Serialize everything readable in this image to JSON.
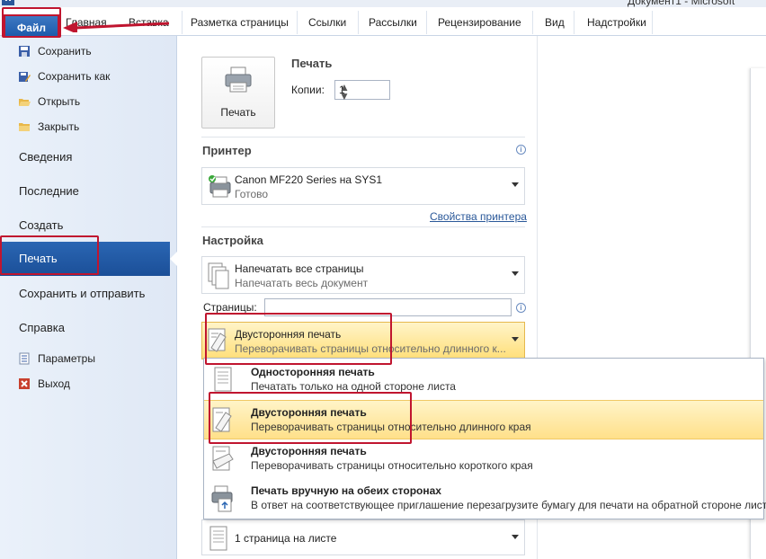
{
  "window": {
    "title": "Документ1 - Microsoft",
    "app_icon": "W"
  },
  "ribbon": {
    "file_tab": "Файл",
    "tabs": [
      "Главная",
      "Вставка",
      "Разметка страницы",
      "Ссылки",
      "Рассылки",
      "Рецензирование",
      "Вид",
      "Надстройки"
    ]
  },
  "sidebar": {
    "commands": [
      {
        "label": "Сохранить",
        "icon": "floppy-disk-icon"
      },
      {
        "label": "Сохранить как",
        "icon": "save-as-icon"
      },
      {
        "label": "Открыть",
        "icon": "open-folder-icon"
      },
      {
        "label": "Закрыть",
        "icon": "close-folder-icon"
      }
    ],
    "sections": [
      "Сведения",
      "Последние",
      "Создать",
      "Печать",
      "Сохранить и отправить",
      "Справка"
    ],
    "active_section": "Печать",
    "bottom_commands": [
      {
        "label": "Параметры",
        "icon": "options-icon"
      },
      {
        "label": "Выход",
        "icon": "exit-icon"
      }
    ]
  },
  "print": {
    "heading": "Печать",
    "button_label": "Печать",
    "copies_label": "Копии:",
    "copies_value": "1",
    "printer_heading": "Принтер",
    "printer_name": "Canon MF220 Series на SYS1",
    "printer_status": "Готово",
    "printer_props_link": "Свойства принтера",
    "settings_heading": "Настройка",
    "pages_option": {
      "title": "Напечатать все страницы",
      "subtitle": "Напечатать весь документ"
    },
    "pages_label": "Страницы:",
    "pages_value": "",
    "duplex_option": {
      "title": "Двусторонняя печать",
      "subtitle": "Переворачивать страницы относительно длинного к..."
    },
    "per_sheet_option": {
      "title": "1 страница на листе"
    }
  },
  "duplex_menu": [
    {
      "title": "Односторонняя печать",
      "subtitle": "Печатать только на одной стороне листа",
      "selected": false
    },
    {
      "title": "Двусторонняя печать",
      "subtitle": "Переворачивать страницы относительно длинного края",
      "selected": true
    },
    {
      "title": "Двусторонняя печать",
      "subtitle": "Переворачивать страницы относительно короткого края",
      "selected": false
    },
    {
      "title": "Печать вручную на обеих сторонах",
      "subtitle": "В ответ на соответствующее приглашение перезагрузите бумагу для печати на обратной стороне листов",
      "selected": false
    }
  ],
  "colors": {
    "accent": "#1d5bab",
    "highlight": "#ffe08a",
    "annotation": "#c0152f"
  }
}
